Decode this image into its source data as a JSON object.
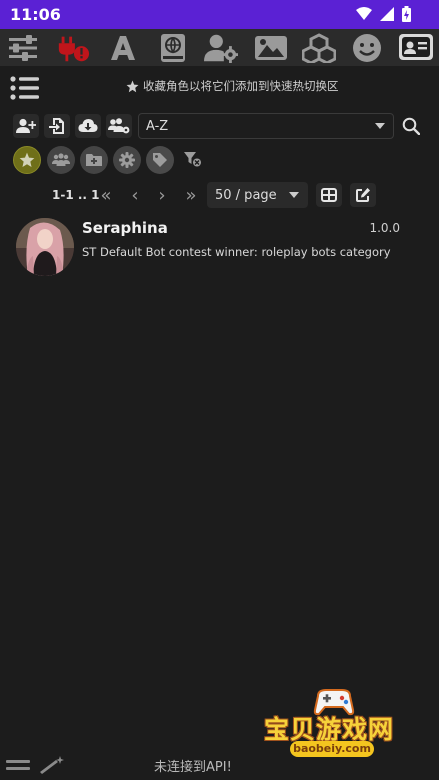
{
  "status_bar": {
    "time": "11:06",
    "icons": [
      "wifi-icon",
      "signal-icon",
      "battery-icon"
    ],
    "bg_color": "#5b21d4"
  },
  "top_nav": {
    "icons": [
      "sliders-icon",
      "plug-alert-icon",
      "font-icon",
      "book-atlas-icon",
      "user-gear-icon",
      "image-icon",
      "cubes-icon",
      "face-smile-icon",
      "address-card-icon"
    ],
    "active": "address-card-icon",
    "alert_color": "#c0151b"
  },
  "hint": {
    "text": "收藏角色以将它们添加到快速热切换区"
  },
  "toolbar": {
    "buttons": [
      "user-plus-icon",
      "file-import-icon",
      "cloud-download-icon",
      "users-gear-icon"
    ],
    "sort_value": "A-Z"
  },
  "filters": {
    "buttons": [
      "star-icon",
      "group-icon",
      "folder-plus-icon",
      "gear-icon",
      "tags-icon"
    ],
    "active": "star-icon",
    "active_color": "#6f6f19"
  },
  "pagination": {
    "range": "1-1 .. 1",
    "per_page": "50 / page"
  },
  "characters": [
    {
      "name": "Seraphina",
      "version": "1.0.0",
      "description": "ST Default Bot contest winner: roleplay bots category"
    }
  ],
  "bottom": {
    "api_status": "未连接到API!"
  },
  "watermark": {
    "text": "宝贝游戏网",
    "url": "baobeiy.com"
  }
}
